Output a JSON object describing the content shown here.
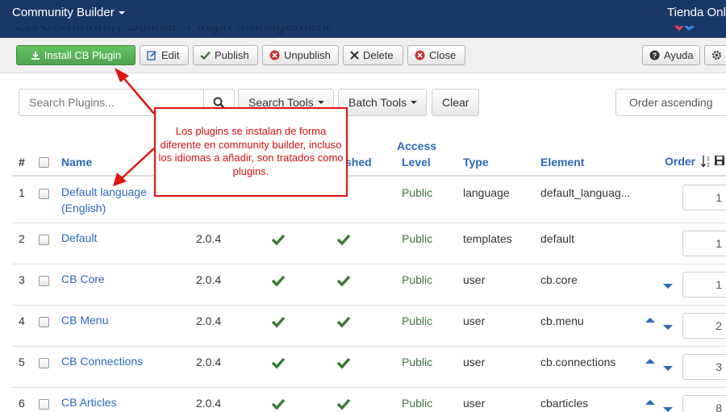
{
  "navbar": {
    "brand": "Community Builder",
    "site": "Tienda Onli"
  },
  "header": {
    "title": "CB Community Builder: Plugin Management"
  },
  "toolbar": {
    "install": "Install CB Plugin",
    "edit": "Edit",
    "publish": "Publish",
    "unpublish": "Unpublish",
    "delete": "Delete",
    "close": "Close",
    "help": "Ayuda"
  },
  "filters": {
    "search_placeholder": "Search Plugins...",
    "search_tools": "Search Tools",
    "batch_tools": "Batch Tools",
    "clear": "Clear",
    "ordering": "Order ascending"
  },
  "table": {
    "headers": {
      "num": "#",
      "name": "Name",
      "published": "shed",
      "access_line1": "Access",
      "access_line2": "Level",
      "type": "Type",
      "element": "Element",
      "order": "Order"
    },
    "rows": [
      {
        "num": "1",
        "name_line1": "Default language",
        "name_line2": "(English)",
        "version": "",
        "access": "Public",
        "type": "language",
        "element": "default_languag...",
        "order": "1"
      },
      {
        "num": "2",
        "name_line1": "Default",
        "name_line2": "",
        "version": "2.0.4",
        "access": "Public",
        "type": "templates",
        "element": "default",
        "order": "1"
      },
      {
        "num": "3",
        "name_line1": "CB Core",
        "name_line2": "",
        "version": "2.0.4",
        "access": "Public",
        "type": "user",
        "element": "cb.core",
        "order": "1"
      },
      {
        "num": "4",
        "name_line1": "CB Menu",
        "name_line2": "",
        "version": "2.0.4",
        "access": "Public",
        "type": "user",
        "element": "cb.menu",
        "order": "2"
      },
      {
        "num": "5",
        "name_line1": "CB Connections",
        "name_line2": "",
        "version": "2.0.4",
        "access": "Public",
        "type": "user",
        "element": "cb.connections",
        "order": "3"
      },
      {
        "num": "6",
        "name_line1": "CB Articles",
        "name_line2": "",
        "version": "2.0.4",
        "access": "Public",
        "type": "user",
        "element": "cbarticles",
        "order": "8"
      }
    ]
  },
  "annotation": {
    "text": "Los plugins se instalan de forma diferente en community builder, incluso los idiomas a añadir, son tratados como plugins.",
    "color": "#e0120f"
  },
  "colors": {
    "navbar": "#1a3867",
    "link": "#2a69b8",
    "success": "#51a351",
    "check": "#3a7a33",
    "public": "#3c763d"
  }
}
